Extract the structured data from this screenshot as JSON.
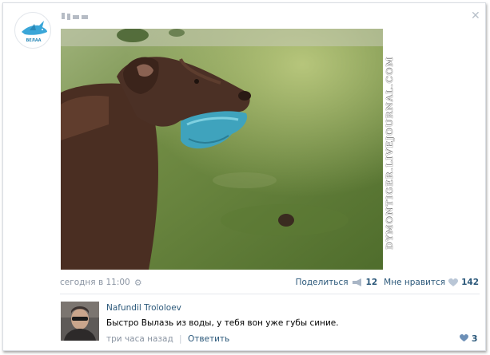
{
  "post": {
    "author_name": "▮▮▮▮",
    "logo_text": "ВЕЛАА",
    "watermark": "DYMONTIGER.LIVEJOURNAL.COM",
    "timestamp": "сегодня в 11:00",
    "share_label": "Поделиться",
    "share_count": "12",
    "like_label": "Мне нравится",
    "like_count": "142"
  },
  "comment": {
    "author": "Nafundil Trololoev",
    "text": "Быстро Вылазь из воды, у тебя вон уже губы синие.",
    "time": "три часа назад",
    "separator": "|",
    "reply_label": "Ответить",
    "likes": "3"
  },
  "icons": {
    "close": "close-icon",
    "gear": "gear-icon",
    "share": "megaphone-icon",
    "like": "heart-icon"
  },
  "colors": {
    "link": "#2b587a",
    "muted": "#8a94a2",
    "frisbee": "#3fa3bd",
    "logo_blue": "#3aa6d8"
  }
}
